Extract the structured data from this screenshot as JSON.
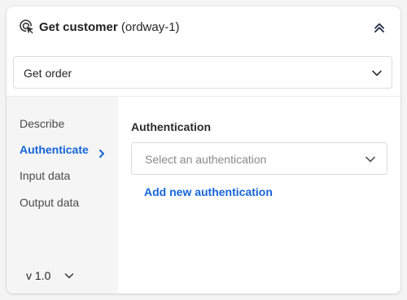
{
  "header": {
    "step_icon": "cursor-click-icon",
    "title": "Get customer",
    "subtitle": "(ordway-1)",
    "collapse_icon": "chevrons-up-icon"
  },
  "operation_select": {
    "value": "Get order",
    "icon": "chevron-down-icon"
  },
  "sidebar": {
    "items": [
      {
        "label": "Describe",
        "active": false
      },
      {
        "label": "Authenticate",
        "active": true
      },
      {
        "label": "Input data",
        "active": false
      },
      {
        "label": "Output data",
        "active": false
      }
    ],
    "active_icon": "chevron-right-icon",
    "version": {
      "label": "v 1.0",
      "icon": "chevron-down-icon"
    }
  },
  "main": {
    "section_label": "Authentication",
    "auth_select": {
      "placeholder": "Select an authentication",
      "icon": "chevron-down-icon"
    },
    "add_link": "Add new authentication"
  },
  "colors": {
    "accent": "#1565d8",
    "sidebar_bg": "#f5f5f5",
    "border": "#dcdcdc"
  }
}
